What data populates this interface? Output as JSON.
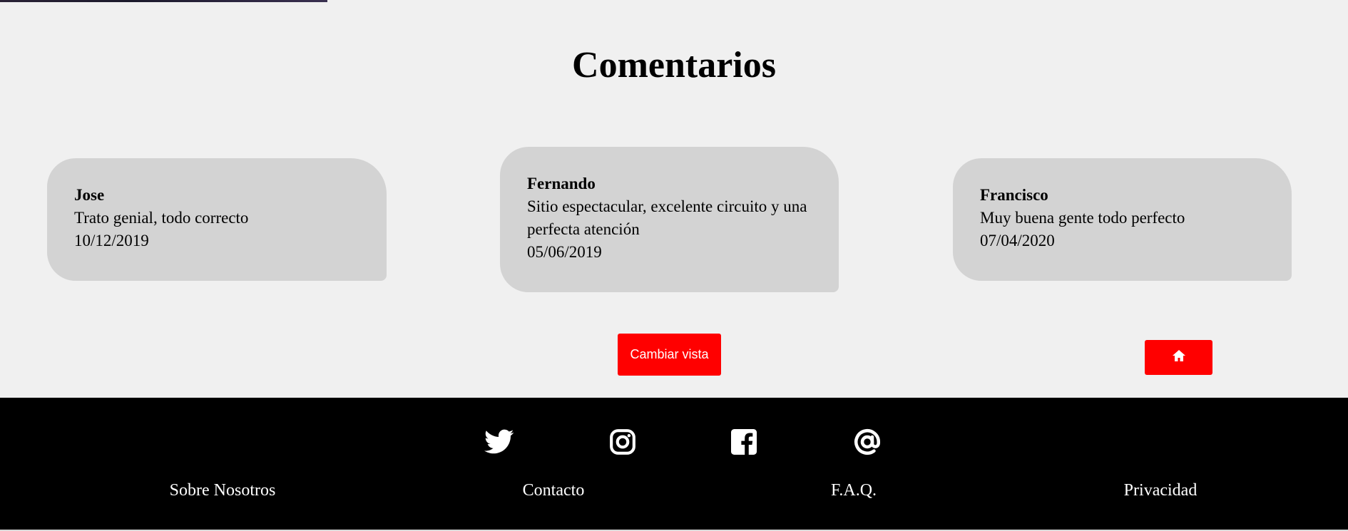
{
  "page": {
    "title": "Comentarios"
  },
  "comments": [
    {
      "author": "Jose",
      "text": "Trato genial, todo correcto",
      "date": "10/12/2019"
    },
    {
      "author": "Fernando",
      "text": "Sitio espectacular, excelente circuito y una perfecta atención",
      "date": "05/06/2019"
    },
    {
      "author": "Francisco",
      "text": "Muy buena gente todo perfecto",
      "date": "07/04/2020"
    }
  ],
  "buttons": {
    "change_view": "Cambiar vista",
    "home_icon": "home-icon"
  },
  "footer": {
    "social": [
      "twitter-icon",
      "instagram-icon",
      "facebook-icon",
      "at-icon"
    ],
    "links": [
      "Sobre Nosotros",
      "Contacto",
      "F.A.Q.",
      "Privacidad"
    ]
  },
  "colors": {
    "background": "#f0f0f0",
    "card": "#d3d3d3",
    "accent": "#ff0000",
    "footer": "#000000"
  }
}
